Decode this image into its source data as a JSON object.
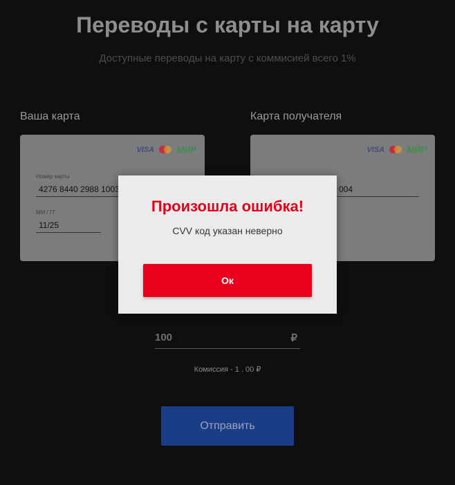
{
  "header": {
    "title": "Переводы с карты на карту",
    "subtitle": "Доступные переводы на карту с коммисией всего 1%"
  },
  "sender_card": {
    "label": "Ваша карта",
    "number_label": "Номер карты",
    "number_value": "4276 8440 2988 1003",
    "expiry_label": "ММ / ГГ",
    "expiry_value": "11/25"
  },
  "recipient_card": {
    "label": "Карта получателя",
    "number_value": "004"
  },
  "payment_logos": {
    "visa": "VISA",
    "mir": "МИР"
  },
  "amount": {
    "value": "100",
    "currency": "₽"
  },
  "commission": "Комиссия - 1 . 00 ₽",
  "submit_label": "Отправить",
  "modal": {
    "title": "Произошла ошибка!",
    "message": "CVV код указан неверно",
    "ok_label": "Ок"
  },
  "colors": {
    "background": "#0f0f10",
    "error": "#e3001b",
    "submit": "#1b3c86"
  }
}
